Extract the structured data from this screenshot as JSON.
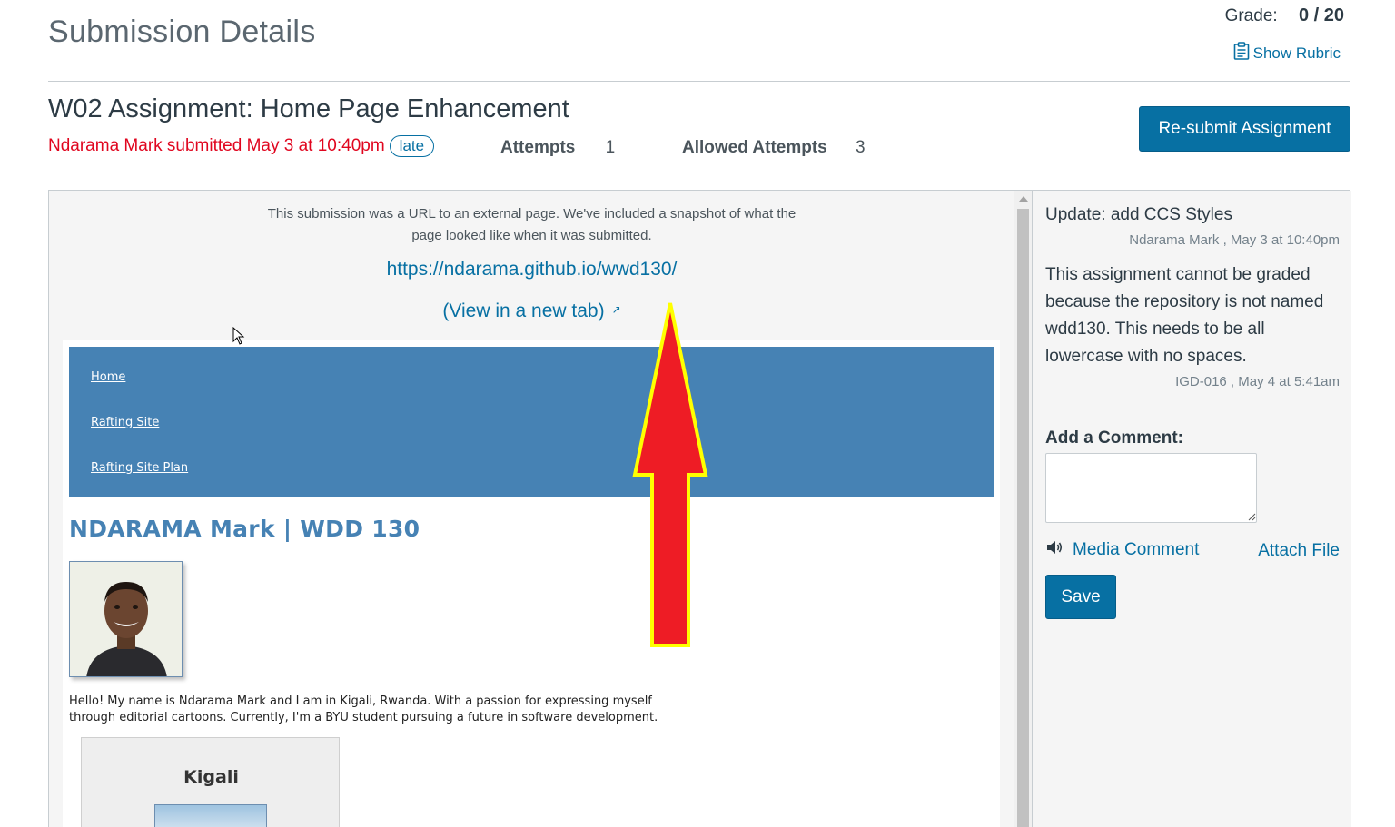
{
  "header": {
    "title": "Submission Details",
    "grade_label": "Grade:",
    "grade_value": "0 / 20",
    "show_rubric": "Show Rubric"
  },
  "assignment": {
    "title": "W02 Assignment: Home Page Enhancement",
    "submitted_text": "Ndarama Mark submitted May 3 at 10:40pm",
    "late_badge": "late",
    "attempts_label": "Attempts",
    "attempts_value": "1",
    "allowed_label": "Allowed Attempts",
    "allowed_value": "3",
    "resubmit_button": "Re-submit Assignment"
  },
  "submission": {
    "notice_line1": "This submission was a URL to an external page. We've included a snapshot of what the",
    "notice_line2": "page looked like when it was submitted.",
    "url": "https://ndarama.github.io/wwd130/",
    "view_new_tab": "(View in a new tab)"
  },
  "snapshot": {
    "nav": [
      "Home",
      "Rafting Site",
      "Rafting Site Plan"
    ],
    "heading": "NDARAMA Mark | WDD 130",
    "bio": "Hello! My name is Ndarama Mark and I am in Kigali, Rwanda. With a passion for expressing myself through editorial cartoons. Currently, I'm a BYU student pursuing a future in software development.",
    "card_title": "Kigali"
  },
  "comments": {
    "title": "Update: add CCS Styles",
    "meta1": "Ndarama Mark , May 3 at 10:40pm",
    "body": "This assignment cannot be graded because the repository is not named wdd130. This needs to be all lowercase with no spaces.",
    "meta2": "IGD-016 , May 4 at 5:41am",
    "add_label": "Add a Comment:",
    "media_comment": "Media Comment",
    "attach_file": "Attach File",
    "save_button": "Save"
  },
  "colors": {
    "link": "#0770a3",
    "late_red": "#e0061f",
    "snapshot_blue": "#4682b4",
    "arrow_red": "#ee1c25",
    "arrow_outline": "#ffff00"
  },
  "icons": {
    "rubric": "clipboard-icon",
    "external": "external-link-icon",
    "media": "speaker-icon",
    "overlay": "red-up-arrow"
  }
}
